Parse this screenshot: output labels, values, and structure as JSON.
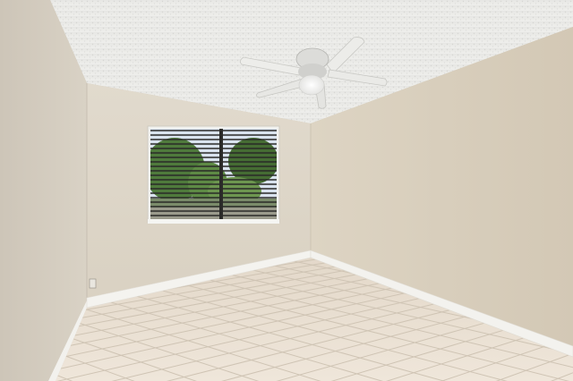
{
  "scene": {
    "subject": "empty-room",
    "colors": {
      "ceiling": "#e9e9e6",
      "left_wall": "#d6cfc2",
      "back_wall": "#ddd5c6",
      "right_wall": "#d8cdbb",
      "floor_tile": "#ebe0d2",
      "grout": "#cfc4b4",
      "baseboard": "#f4f3ef",
      "window_frame": "#f1f1ee",
      "foliage": "#4f7a3c",
      "sky": "#d9e3ee",
      "fan_blade": "#ececea",
      "fan_light": "#ffffff"
    }
  }
}
